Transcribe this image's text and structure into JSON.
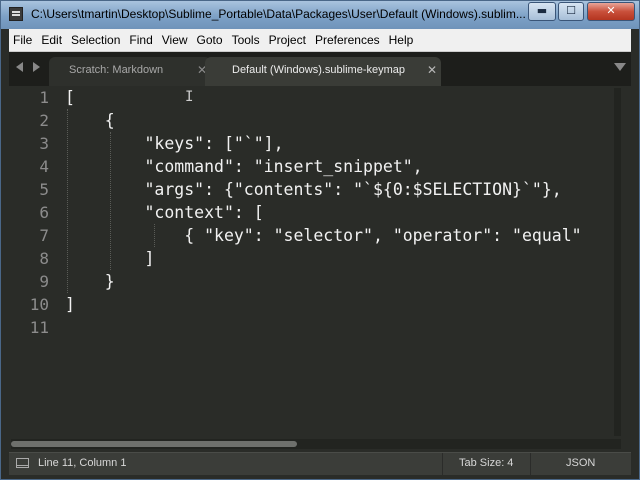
{
  "window": {
    "title": "C:\\Users\\tmartin\\Desktop\\Sublime_Portable\\Data\\Packages\\User\\Default (Windows).sublim...",
    "minimize_glyph": "▬",
    "maximize_glyph": "☐",
    "close_glyph": "✕"
  },
  "menu": [
    "File",
    "Edit",
    "Selection",
    "Find",
    "View",
    "Goto",
    "Tools",
    "Project",
    "Preferences",
    "Help"
  ],
  "tabs": [
    {
      "label": "Scratch: Markdown",
      "close": "✕",
      "active": false
    },
    {
      "label": "Default (Windows).sublime-keymap",
      "close": "✕",
      "active": true
    }
  ],
  "editor": {
    "line_numbers": [
      "1",
      "2",
      "3",
      "4",
      "5",
      "6",
      "7",
      "8",
      "9",
      "10",
      "11"
    ],
    "lines": [
      "[",
      "    {",
      "        \"keys\": [\"`\"],",
      "        \"command\": \"insert_snippet\",",
      "        \"args\": {\"contents\": \"`${0:$SELECTION}`\"},",
      "        \"context\": [",
      "            { \"key\": \"selector\", \"operator\": \"equal\"",
      "        ]",
      "    }",
      "]",
      ""
    ],
    "cursor_glyph": "I"
  },
  "status": {
    "position": "Line 11, Column 1",
    "tab_size": "Tab Size: 4",
    "syntax": "JSON"
  },
  "colors": {
    "editor_bg": "#2a2c28",
    "text": "#f1f1f1",
    "line_number": "#8c8c8c",
    "titlebar": "#7da1c6"
  }
}
